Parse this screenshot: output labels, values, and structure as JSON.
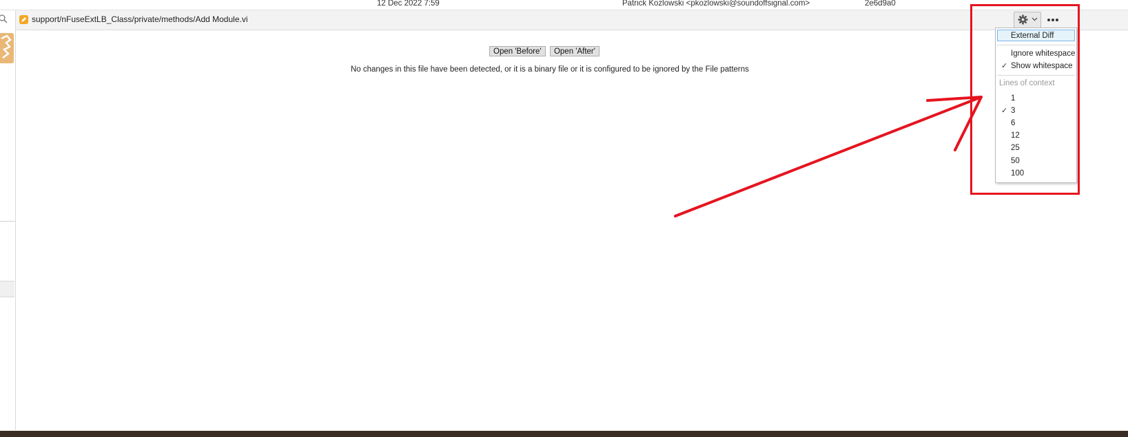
{
  "commit_row": {
    "date": "12 Dec 2022 7:59",
    "author": "Patrick Kozlowski <pkozlowski@soundoffsignal.com>",
    "hash": "2e6d9a0"
  },
  "file_header": {
    "path": "support/nFuseExtLB_Class/private/methods/Add Module.vi"
  },
  "diff": {
    "open_before_label": "Open 'Before'",
    "open_after_label": "Open 'After'",
    "message": "No changes in this file have been detected, or it is a binary file or it is configured to be ignored by the File patterns"
  },
  "settings_menu": {
    "external_diff": "External Diff",
    "ignore_whitespace": "Ignore whitespace",
    "show_whitespace": "Show whitespace",
    "show_whitespace_checked": true,
    "lines_of_context_heading": "Lines of context",
    "context_options": [
      "1",
      "3",
      "6",
      "12",
      "25",
      "50",
      "100"
    ],
    "selected_context": "3"
  },
  "colors": {
    "annotation": "#e5141f",
    "file_icon": "#f5a623",
    "menu_highlight": "#e5f3fb"
  },
  "icons": [
    "search-icon",
    "file-modified-icon",
    "gear-icon",
    "chevron-down-icon",
    "more-icon",
    "check-icon"
  ]
}
